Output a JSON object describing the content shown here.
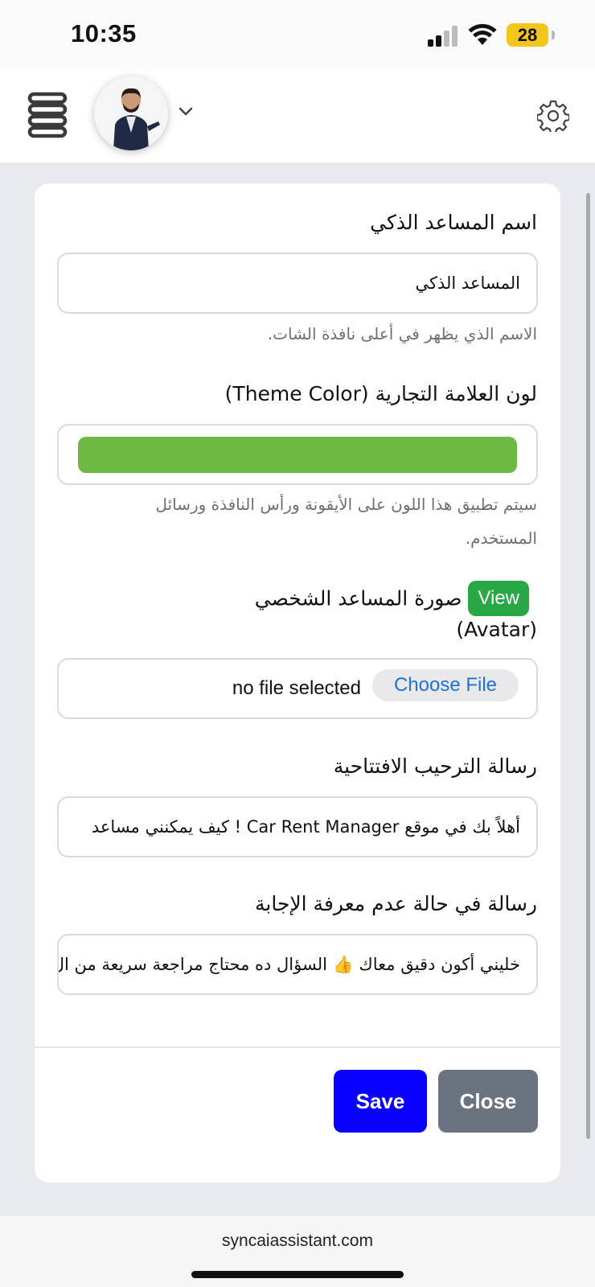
{
  "status_bar": {
    "time": "10:35",
    "battery": "28"
  },
  "header": {
    "avatar_name": "assistant-avatar"
  },
  "form": {
    "name": {
      "label": "اسم المساعد الذكي",
      "value": "المساعد الذكي",
      "hint": "الاسم الذي يظهر في أعلى نافذة الشات."
    },
    "theme": {
      "label": "لون العلامة التجارية (Theme Color)",
      "color": "#6cb944",
      "hint_line1": "سيتم تطبيق هذا اللون على الأيقونة ورأس النافذة ورسائل",
      "hint_line2": "المستخدم."
    },
    "avatar": {
      "view_label": "View",
      "label_line1": "صورة المساعد الشخصي",
      "label_line2": "(Avatar)",
      "choose_label": "Choose File",
      "file_status": "no file selected"
    },
    "welcome": {
      "label": "رسالة الترحيب الافتتاحية",
      "value": "أهلاً بك في موقع  Car Rent Manager ! كيف يمكنني مساعد"
    },
    "fallback": {
      "label": "رسالة في حالة عدم معرفة الإجابة",
      "value": "خليني أكون دقيق معاك 👍 السؤال ده محتاج مراجعة سريعة من ال"
    }
  },
  "actions": {
    "save_label": "Save",
    "close_label": "Close",
    "save_color": "#0a00ff",
    "close_color": "#6b7280"
  },
  "footer": {
    "url": "syncaiassistant.com"
  }
}
